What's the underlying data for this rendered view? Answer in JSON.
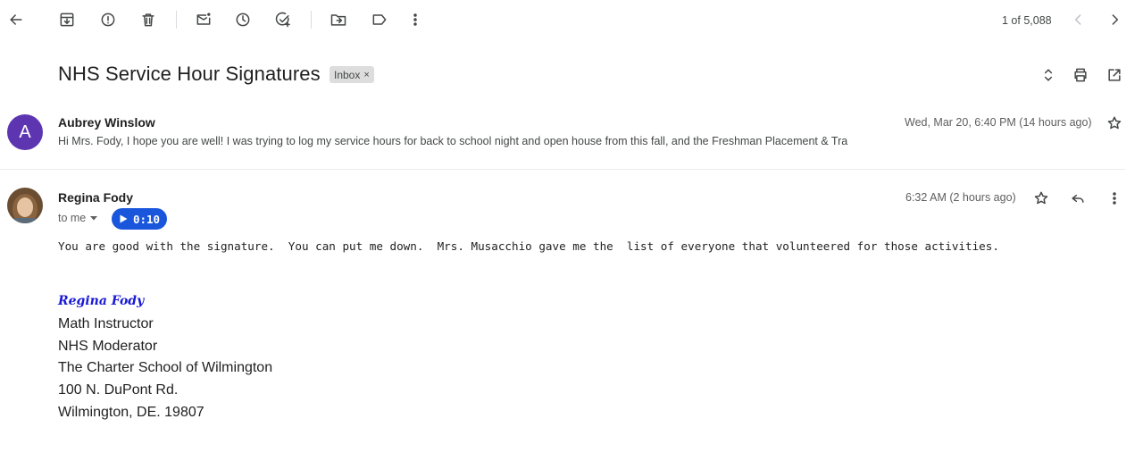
{
  "toolbar": {
    "counter": "1 of 5,088"
  },
  "thread": {
    "subject": "NHS Service Hour Signatures",
    "label": "Inbox",
    "label_remove": "×"
  },
  "messages": [
    {
      "avatar_letter": "A",
      "sender": "Aubrey Winslow",
      "date": "Wed, Mar 20, 6:40 PM (14 hours ago)",
      "snippet": "Hi Mrs. Fody, I hope you are well! I was trying to log my service hours for back to school night and open house from this fall, and the Freshman Placement & Tra"
    },
    {
      "sender": "Regina Fody",
      "date": "6:32 AM (2 hours ago)",
      "recipient": "to me",
      "audio_duration": "0:10",
      "body": "You are good with the signature.  You can put me down.  Mrs. Musacchio gave me the  list of everyone that volunteered for those activities.",
      "signature": {
        "name": "Regina Fody",
        "lines": [
          "Math Instructor",
          "NHS Moderator",
          "The Charter School of Wilmington",
          "100 N. DuPont Rd.",
          "Wilmington, DE. 19807"
        ]
      }
    }
  ],
  "colors": {
    "avatar_a": "#5e35b1",
    "audio_pill": "#1a56db",
    "signature_name": "#1a1ad6"
  }
}
